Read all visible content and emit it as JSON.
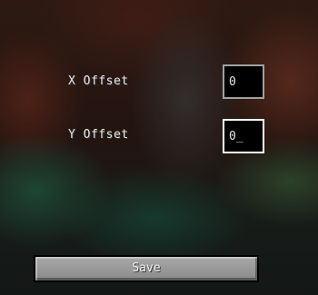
{
  "settings": {
    "x_offset": {
      "label": "X Offset",
      "value": "0"
    },
    "y_offset": {
      "label": "Y Offset",
      "value": "0_"
    }
  },
  "save_button": {
    "label": "Save"
  }
}
